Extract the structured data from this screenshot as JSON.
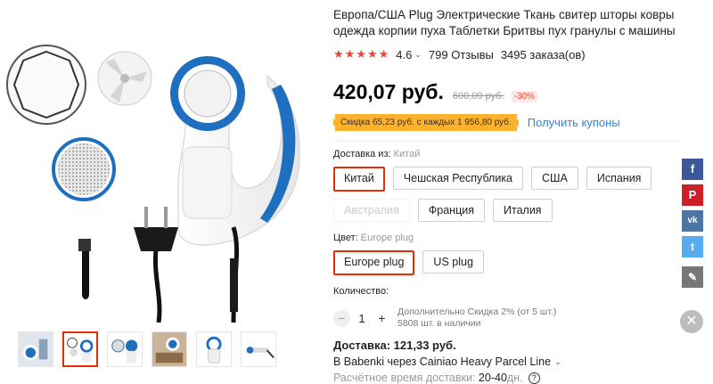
{
  "product": {
    "title": "Европа/США Plug Электрические Ткань свитер шторы ковры одежда корпии пуха Таблетки Бритвы пух гранулы с машины",
    "stars": [
      "★",
      "★",
      "★",
      "★",
      "★"
    ],
    "rating": "4.6",
    "rating_value": 4.6,
    "reviews": "799 Отзывы",
    "orders": "3495 заказа(ов)"
  },
  "price": {
    "current": "420,07 руб.",
    "old": "600,09 руб.",
    "discount": "-30%"
  },
  "coupon": {
    "badge": "Скидка 65,23 руб. с каждых 1 956,80 руб.",
    "link": "Получить купоны"
  },
  "shipping_from": {
    "label": "Доставка из:",
    "selected_label": "Китай",
    "options": [
      {
        "label": "Китай",
        "state": "selected"
      },
      {
        "label": "Чешская Республика",
        "state": "normal"
      },
      {
        "label": "США",
        "state": "normal"
      },
      {
        "label": "Испания",
        "state": "normal"
      },
      {
        "label": "Австралия",
        "state": "disabled"
      },
      {
        "label": "Франция",
        "state": "normal"
      },
      {
        "label": "Италия",
        "state": "normal"
      }
    ]
  },
  "color": {
    "label": "Цвет:",
    "selected_label": "Europe plug",
    "options": [
      {
        "label": "Europe plug",
        "state": "selected"
      },
      {
        "label": "US plug",
        "state": "normal"
      }
    ]
  },
  "quantity": {
    "label": "Количество:",
    "minus": "−",
    "plus": "+",
    "value": "1",
    "note_line1": "Дополнительно Скидка 2% (от 5 шт.)",
    "note_line2": "5808 шт. в наличии"
  },
  "delivery": {
    "title": "Доставка: 121,33 руб.",
    "method": "В Babenki через Cainiao Heavy Parcel Line",
    "eta_label": "Расчётное время доставки:",
    "eta_value": "20-40",
    "eta_unit": "дн.",
    "help": "?"
  },
  "social": {
    "facebook": "f",
    "pinterest": "P",
    "vk": "vk",
    "twitter": "t",
    "edit": "✎",
    "close": "✕"
  },
  "colors": {
    "accent_red": "#e62e04",
    "link_blue": "#2f87d8",
    "coupon_orange": "#ffb22e",
    "product_blue": "#1e6fc0"
  }
}
